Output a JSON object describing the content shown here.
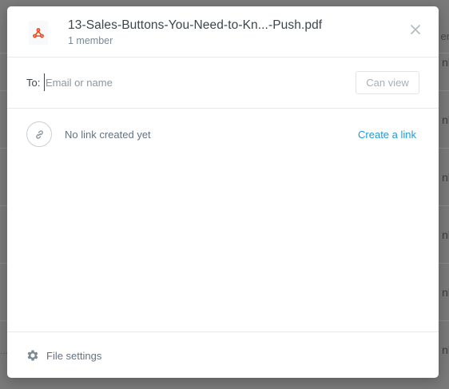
{
  "background": {
    "header_text": "en",
    "row_texts": [
      "nl",
      "nl",
      "nl",
      "nl",
      "nl",
      "nl"
    ],
    "footer_dots": "..."
  },
  "modal": {
    "file": {
      "icon": "pdf-icon",
      "title": "13-Sales-Buttons-You-Need-to-Kn...-Push.pdf",
      "members": "1 member"
    },
    "share": {
      "to_label": "To:",
      "input_placeholder": "Email or name",
      "input_value": "",
      "permission_label": "Can view"
    },
    "link": {
      "icon": "link-icon",
      "status_text": "No link created yet",
      "action_label": "Create a link"
    },
    "footer": {
      "icon": "gear-icon",
      "settings_label": "File settings"
    },
    "colors": {
      "accent": "#1d9ad6",
      "pdf_icon": "#e8491d",
      "text_primary": "#3d464d",
      "text_secondary": "#637282"
    }
  }
}
